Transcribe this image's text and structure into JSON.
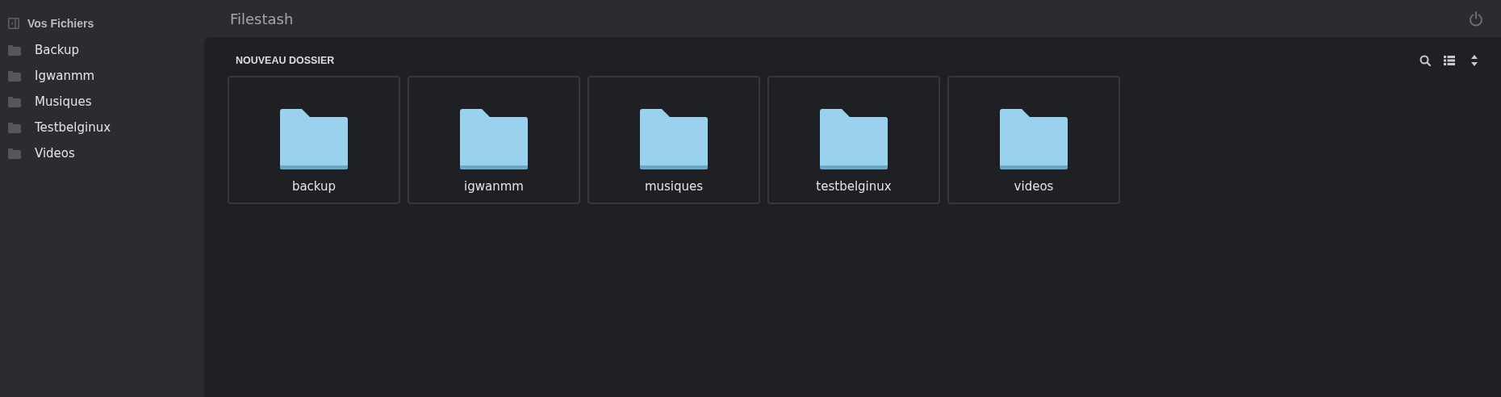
{
  "sidebar": {
    "title": "Vos Fichiers",
    "items": [
      {
        "label": "Backup"
      },
      {
        "label": "Igwanmm"
      },
      {
        "label": "Musiques"
      },
      {
        "label": "Testbelginux"
      },
      {
        "label": "Videos"
      }
    ]
  },
  "header": {
    "title": "Filestash"
  },
  "toolbar": {
    "new_folder": "NOUVEAU DOSSIER"
  },
  "files": [
    {
      "name": "backup",
      "kind": "folder"
    },
    {
      "name": "igwanmm",
      "kind": "folder"
    },
    {
      "name": "musiques",
      "kind": "folder"
    },
    {
      "name": "testbelginux",
      "kind": "folder"
    },
    {
      "name": "videos",
      "kind": "folder"
    }
  ]
}
